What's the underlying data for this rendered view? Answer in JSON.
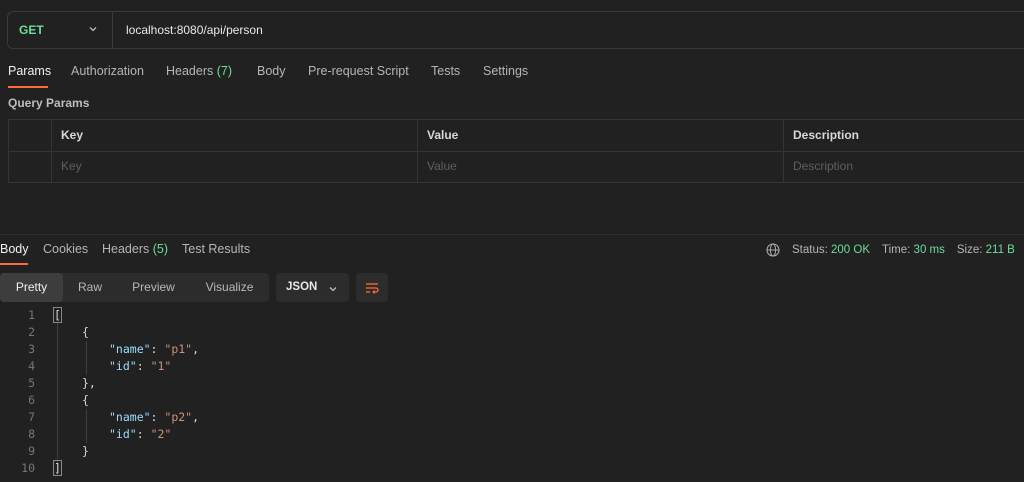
{
  "request": {
    "method": "GET",
    "url": "localhost:8080/api/person"
  },
  "request_tabs": {
    "params": "Params",
    "authorization": "Authorization",
    "headers_label": "Headers",
    "headers_count": "(7)",
    "body": "Body",
    "pre_request_script": "Pre-request Script",
    "tests": "Tests",
    "settings": "Settings"
  },
  "query_params": {
    "title": "Query Params",
    "columns": [
      "Key",
      "Value",
      "Description"
    ],
    "placeholders": [
      "Key",
      "Value",
      "Description"
    ]
  },
  "response_tabs": {
    "body": "Body",
    "cookies": "Cookies",
    "headers_label": "Headers",
    "headers_count": "(5)",
    "test_results": "Test Results"
  },
  "status": {
    "status_label": "Status:",
    "status_value": "200 OK",
    "time_label": "Time:",
    "time_value": "30 ms",
    "size_label": "Size:",
    "size_value": "211 B"
  },
  "view_modes": [
    "Pretty",
    "Raw",
    "Preview",
    "Visualize"
  ],
  "format": "JSON",
  "code": {
    "line_numbers": [
      "1",
      "2",
      "3",
      "4",
      "5",
      "6",
      "7",
      "8",
      "9",
      "10"
    ],
    "open_array": "[",
    "close_array": "]",
    "open_obj": "{",
    "close_obj_comma": "},",
    "close_obj": "}",
    "colon": ": ",
    "comma": ",",
    "name_key": "\"name\"",
    "id_key": "\"id\"",
    "obj1_name": "\"p1\"",
    "obj1_id": "\"1\"",
    "obj2_name": "\"p2\"",
    "obj2_id": "\"2\""
  },
  "colors": {
    "accent": "#ff6c37",
    "success": "#6bdd9a",
    "background": "#212121",
    "json_key": "#9cdcfe",
    "json_string": "#ce9178"
  },
  "icons": {
    "method_dropdown": "chevron-down-icon",
    "globe": "globe-icon",
    "format_dropdown": "chevron-down-icon",
    "wrap": "wrap-lines-icon"
  }
}
